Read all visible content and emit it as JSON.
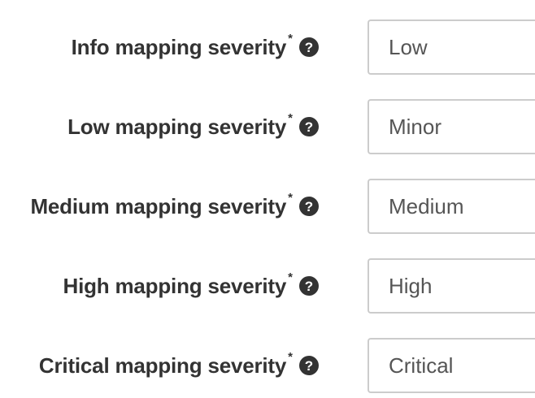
{
  "form": {
    "fields": [
      {
        "label": "Info mapping severity",
        "required_mark": "*",
        "help_icon": "question-circle-icon",
        "value": "Low"
      },
      {
        "label": "Low mapping severity",
        "required_mark": "*",
        "help_icon": "question-circle-icon",
        "value": "Minor"
      },
      {
        "label": "Medium mapping severity",
        "required_mark": "*",
        "help_icon": "question-circle-icon",
        "value": "Medium"
      },
      {
        "label": "High mapping severity",
        "required_mark": "*",
        "help_icon": "question-circle-icon",
        "value": "High"
      },
      {
        "label": "Critical mapping severity",
        "required_mark": "*",
        "help_icon": "question-circle-icon",
        "value": "Critical"
      }
    ],
    "help_glyph": "?"
  }
}
